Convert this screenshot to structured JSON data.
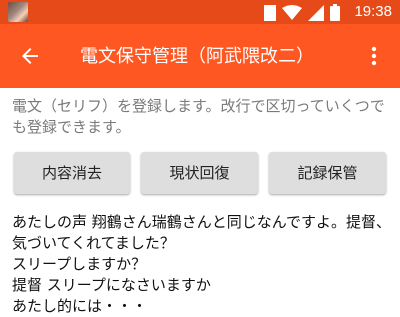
{
  "status_bar": {
    "time": "19:38",
    "icons": [
      "wifi-icon",
      "signal-icon",
      "battery-icon"
    ],
    "background": "#e64a19"
  },
  "app_bar": {
    "title": "電文保守管理（阿武隈改二）",
    "background": "#ff5722",
    "back_icon": "arrow-back-icon",
    "menu_icon": "more-vert-icon"
  },
  "description": "電文（セリフ）を登録します。改行で区切っていくつでも登録できます。",
  "buttons": {
    "clear": "内容消去",
    "restore": "現状回復",
    "save": "記録保管"
  },
  "content_text": "あたしの声 翔鶴さん瑞鶴さんと同じなんですよ。提督、気づいてくれてました？\nスリープしますか？\n提督 スリープになさいますか\nあたし的には・・・"
}
